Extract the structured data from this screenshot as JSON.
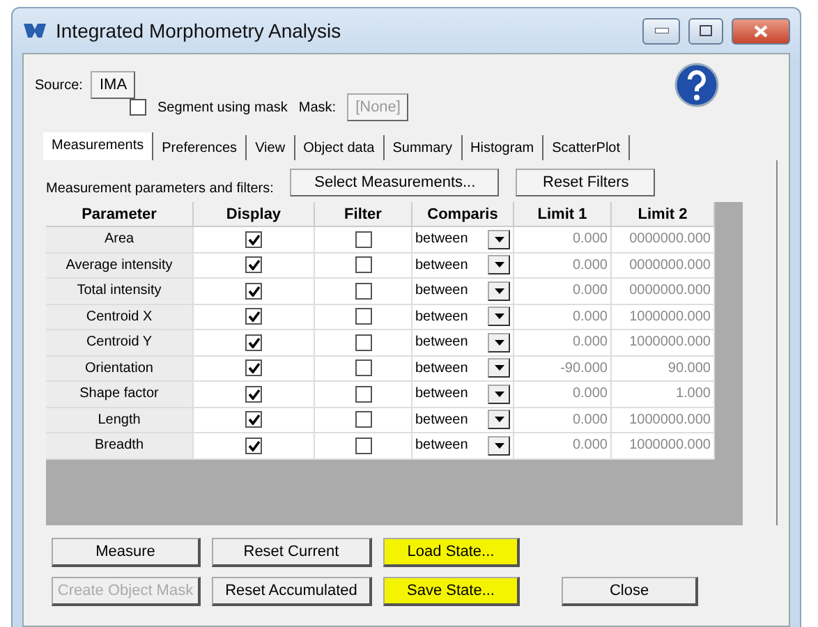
{
  "window": {
    "title": "Integrated Morphometry Analysis"
  },
  "source": {
    "label": "Source:",
    "value": "IMA"
  },
  "segment": {
    "label": "Segment using mask",
    "checked": false
  },
  "mask": {
    "label": "Mask:",
    "value": "[None]",
    "disabled": true
  },
  "tabs": [
    {
      "label": "Measurements",
      "selected": true
    },
    {
      "label": "Preferences",
      "selected": false
    },
    {
      "label": "View",
      "selected": false
    },
    {
      "label": "Object data",
      "selected": false
    },
    {
      "label": "Summary",
      "selected": false
    },
    {
      "label": "Histogram",
      "selected": false
    },
    {
      "label": "ScatterPlot",
      "selected": false
    }
  ],
  "filters_label": "Measurement parameters and filters:",
  "top_buttons": [
    "Select Measurements...",
    "Reset Filters"
  ],
  "table": {
    "columns": [
      "Parameter",
      "Display",
      "Filter",
      "Comparis",
      "Limit 1",
      "Limit 2"
    ],
    "rows": [
      {
        "parameter": "Area",
        "display": true,
        "filter": false,
        "comparison": "between",
        "limit_1": "0.000",
        "limit_2": "0000000.000"
      },
      {
        "parameter": "Average intensity",
        "display": true,
        "filter": false,
        "comparison": "between",
        "limit_1": "0.000",
        "limit_2": "0000000.000"
      },
      {
        "parameter": "Total intensity",
        "display": true,
        "filter": false,
        "comparison": "between",
        "limit_1": "0.000",
        "limit_2": "0000000.000"
      },
      {
        "parameter": "Centroid X",
        "display": true,
        "filter": false,
        "comparison": "between",
        "limit_1": "0.000",
        "limit_2": "1000000.000"
      },
      {
        "parameter": "Centroid Y",
        "display": true,
        "filter": false,
        "comparison": "between",
        "limit_1": "0.000",
        "limit_2": "1000000.000"
      },
      {
        "parameter": "Orientation",
        "display": true,
        "filter": false,
        "comparison": "between",
        "limit_1": "-90.000",
        "limit_2": "90.000"
      },
      {
        "parameter": "Shape factor",
        "display": true,
        "filter": false,
        "comparison": "between",
        "limit_1": "0.000",
        "limit_2": "1.000"
      },
      {
        "parameter": "Length",
        "display": true,
        "filter": false,
        "comparison": "between",
        "limit_1": "0.000",
        "limit_2": "1000000.000"
      },
      {
        "parameter": "Breadth",
        "display": true,
        "filter": false,
        "comparison": "between",
        "limit_1": "0.000",
        "limit_2": "1000000.000"
      }
    ]
  },
  "bottom_buttons": [
    {
      "label": "Measure",
      "disabled": false,
      "highlighted": false
    },
    {
      "label": "Reset Current",
      "disabled": false,
      "highlighted": false
    },
    {
      "label": "Load State...",
      "disabled": false,
      "highlighted": true
    },
    {
      "label": "Create Object Mask",
      "disabled": true,
      "highlighted": false
    },
    {
      "label": "Reset Accumulated",
      "disabled": false,
      "highlighted": false
    },
    {
      "label": "Save State...",
      "disabled": false,
      "highlighted": true
    },
    {
      "label": "Close",
      "disabled": false,
      "highlighted": false
    }
  ]
}
